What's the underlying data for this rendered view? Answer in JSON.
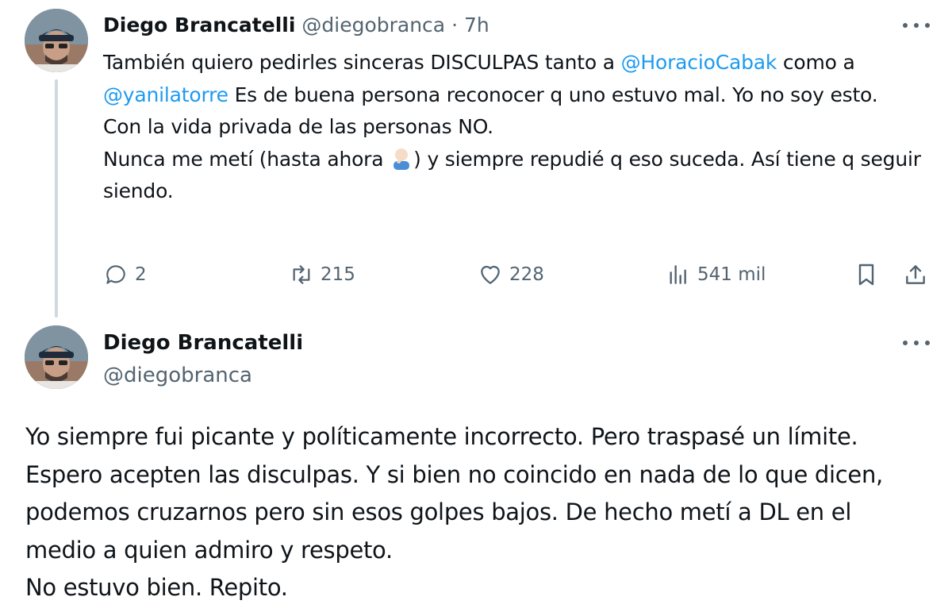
{
  "tweet1": {
    "author_name": "Diego Brancatelli",
    "author_handle": "@diegobranca",
    "separator": "·",
    "time": "7h",
    "text_part1": "También quiero pedirles sinceras DISCULPAS tanto a ",
    "mention1": "@HoracioCabak",
    "text_part2": " como a ",
    "mention2": "@yanilatorre",
    "text_part3": " Es de buena persona reconocer q uno estuvo mal. Yo no soy esto.",
    "line2": "Con la vida privada de las personas NO.",
    "line3_part1": "Nunca me metí (hasta ahora ",
    "line3_emoji": "facepalm-emoji",
    "line3_part2": ") y siempre repudié q eso suceda. Así tiene q seguir siendo.",
    "stats": {
      "replies": "2",
      "retweets": "215",
      "likes": "228",
      "views": "541 mil"
    }
  },
  "tweet2": {
    "author_name": "Diego Brancatelli",
    "author_handle": "@diegobranca",
    "line1": "Yo siempre fui picante y políticamente incorrecto. Pero traspasé un límite.",
    "line2": "Espero acepten las disculpas. Y si bien no coincido en nada de lo que dicen,",
    "line3": "podemos cruzarnos pero sin esos golpes bajos. De hecho metí a DL en el",
    "line4": "medio a quien admiro y respeto.",
    "line5": "No estuvo bien. Repito."
  },
  "icons": {
    "reply": "reply-icon",
    "retweet": "retweet-icon",
    "like": "heart-icon",
    "views": "views-icon",
    "bookmark": "bookmark-icon",
    "share": "share-icon",
    "more": "more-icon"
  },
  "colors": {
    "link": "#1d9bf0",
    "secondary_text": "#536471",
    "thread_line": "#cfd9de"
  }
}
